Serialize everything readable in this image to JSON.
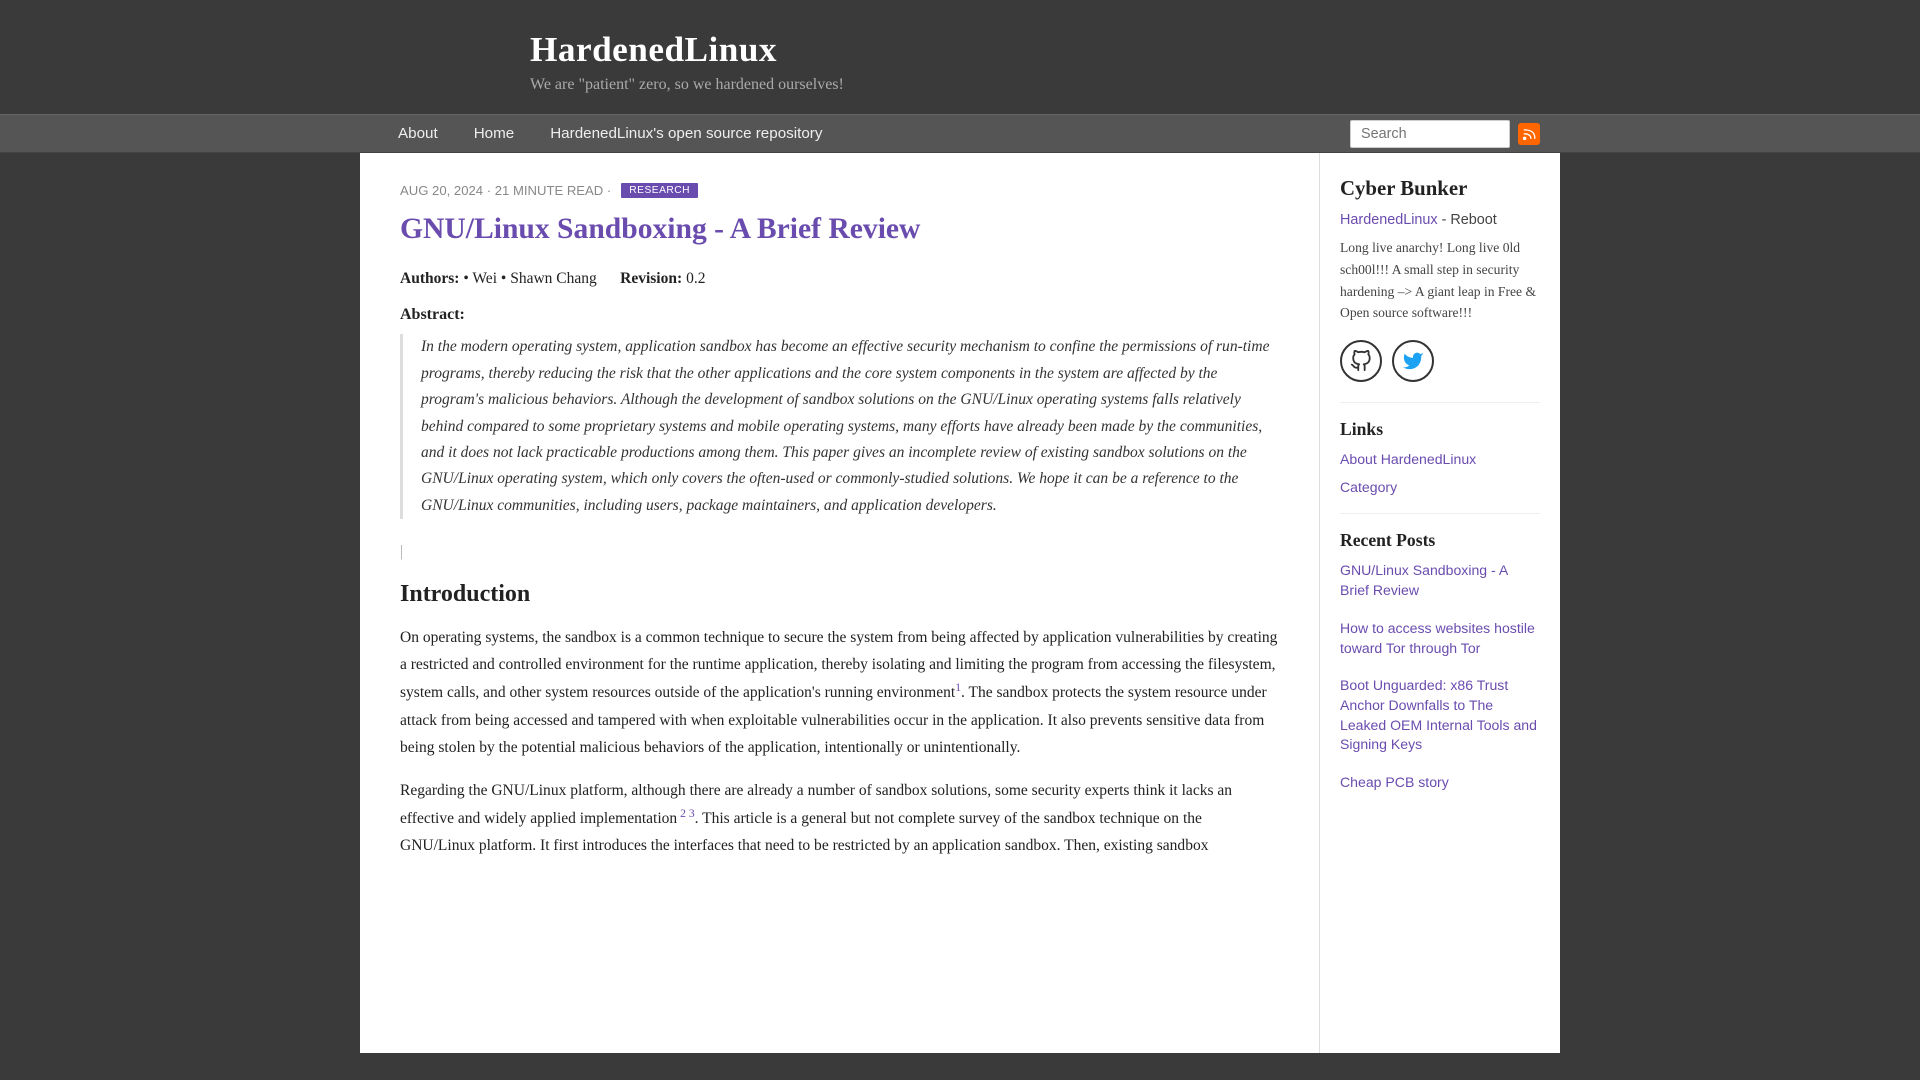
{
  "site": {
    "title": "HardenedLinux",
    "tagline": "We are \"patient\" zero, so we hardened ourselves!"
  },
  "nav": {
    "links": [
      {
        "label": "About",
        "href": "#"
      },
      {
        "label": "Home",
        "href": "#"
      },
      {
        "label": "HardenedLinux's open source repository",
        "href": "#"
      }
    ],
    "search_placeholder": "Search"
  },
  "article": {
    "meta": "AUG 20, 2024 · 21 MINUTE READ ·",
    "tag": "RESEARCH",
    "title": "GNU/Linux Sandboxing - A Brief Review",
    "authors_label": "Authors:",
    "authors": "• Wei  • Shawn Chang",
    "revision_label": "Revision:",
    "revision": "0.2",
    "abstract_label": "Abstract:",
    "abstract": "In the modern operating system, application sandbox has become an effective security mechanism to confine the permissions of run-time programs, thereby reducing the risk that the other applications and the core system components in the system are affected by the program's malicious behaviors. Although the development of sandbox solutions on the GNU/Linux operating systems falls relatively behind compared to some proprietary systems and mobile operating systems, many efforts have already been made by the communities, and it does not lack practicable productions among them. This paper gives an incomplete review of existing sandbox solutions on the GNU/Linux operating system, which only covers the often-used or commonly-studied solutions. We hope it can be a reference to the GNU/Linux communities, including users, package maintainers, and application developers.",
    "intro_heading": "Introduction",
    "intro_p1": "On operating systems, the sandbox is a common technique to secure the system from being affected by application vulnerabilities by creating a restricted and controlled environment for the runtime application, thereby isolating and limiting the program from accessing the filesystem, system calls, and other system resources outside of the application's running environment",
    "intro_p1_ref": "1",
    "intro_p1_cont": ". The sandbox protects the system resource under attack from being accessed and tampered with when exploitable vulnerabilities occur in the application. It also prevents sensitive data from being stolen by the potential malicious behaviors of the application, intentionally or unintentionally.",
    "intro_p2_start": "Regarding the GNU/Linux platform, although there are already a number of sandbox solutions, some security experts think it lacks an effective and widely applied implementation",
    "intro_p2_refs": "2 3",
    "intro_p2_cont": ". This article is a general but not complete survey of the sandbox technique on the GNU/Linux platform. It first introduces the interfaces that need to be restricted by an application sandbox. Then, existing sandbox"
  },
  "sidebar": {
    "cyber_bunker_title": "Cyber Bunker",
    "hardenedlinux_label": "HardenedLinux",
    "hardenedlinux_suffix": " - Reboot",
    "cyber_bunker_desc": "Long live anarchy! Long live 0ld sch00l!!! A small step in security hardening –> A giant leap in Free & Open source software!!!",
    "links_title": "Links",
    "links": [
      {
        "label": "About HardenedLinux",
        "href": "#"
      },
      {
        "label": "Category",
        "href": "#"
      }
    ],
    "recent_posts_title": "Recent Posts",
    "recent_posts": [
      {
        "label": "GNU/Linux Sandboxing - A Brief Review",
        "href": "#"
      },
      {
        "label": "How to access websites hostile toward Tor through Tor",
        "href": "#"
      },
      {
        "label": "Boot Unguarded: x86 Trust Anchor Downfalls to The Leaked OEM Internal Tools and Signing Keys",
        "href": "#"
      },
      {
        "label": "Cheap PCB story",
        "href": "#"
      }
    ]
  }
}
